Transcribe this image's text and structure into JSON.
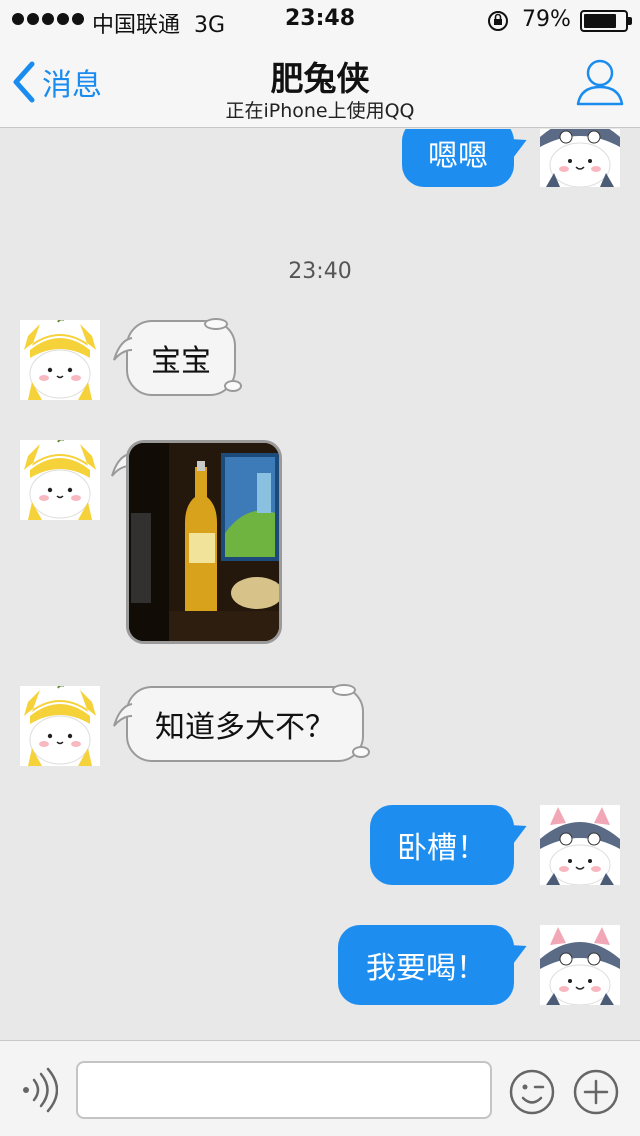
{
  "status_bar": {
    "carrier": "中国联通",
    "network": "3G",
    "time": "23:48",
    "battery": "79%",
    "battery_level": 0.79
  },
  "nav": {
    "back_label": "消息",
    "title": "肥兔侠",
    "subtitle": "正在iPhone上使用QQ"
  },
  "messages": {
    "m1": "嗯嗯",
    "timestamp": "23:40",
    "m2": "宝宝",
    "m4": "知道多大不？",
    "m5": "卧槽！",
    "m6": "我要喝！"
  },
  "colors": {
    "accent": "#1a8cf0",
    "outgoing_bubble": "#1d8ef0",
    "incoming_bubble": "#f5f5f5",
    "background": "#e8e8e8"
  },
  "icons": {
    "back": "chevron-left-icon",
    "profile": "person-outline-icon",
    "voice": "voice-icon",
    "emoji": "emoji-icon",
    "plus": "plus-icon"
  }
}
